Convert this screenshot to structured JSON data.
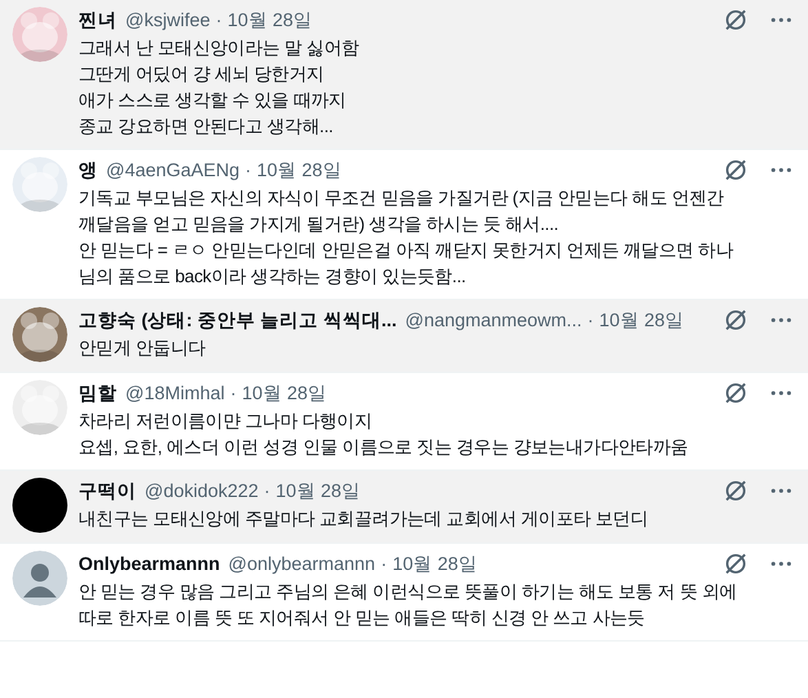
{
  "tweets": [
    {
      "name": "찐녀",
      "handle": "@ksjwifee",
      "separator": "·",
      "date": "10월 28일",
      "highlighted": true,
      "text": "그래서 난 모태신앙이라는 말 싫어함\n그딴게 어딨어 걍 세뇌 당한거지\n애가 스스로 생각할 수 있을 때까지\n종교 강요하면 안된다고 생각해..."
    },
    {
      "name": "앵",
      "handle": "@4aenGaAENg",
      "separator": "·",
      "date": "10월 28일",
      "highlighted": false,
      "text": "기독교 부모님은 자신의 자식이 무조건 믿음을 가질거란 (지금 안믿는다 해도 언젠간\n깨달음을 얻고 믿음을 가지게 될거란) 생각을 하시는 듯 해서....\n안 믿는다 = ㄹㅇ 안믿는다인데 안믿은걸 아직 깨닫지 못한거지 언제든 깨달으면 하나\n님의 품으로 back이라 생각하는 경향이 있는듯함..."
    },
    {
      "name": "고향숙 (상태: 중안부 늘리고 씩씩대...",
      "handle": "@nangmanmeowm...",
      "separator": "·",
      "date": "10월 28일",
      "highlighted": true,
      "text": "안믿게 안둡니다"
    },
    {
      "name": "밈할",
      "handle": "@18Mimhal",
      "separator": "·",
      "date": "10월 28일",
      "highlighted": false,
      "text": "차라리 저런이름이먄 그나마 다행이지\n요셉, 요한, 에스더 이런 성경 인물 이름으로 짓는 경우는 걍보는내가다안타까움"
    },
    {
      "name": "구떡이",
      "handle": "@dokidok222",
      "separator": "·",
      "date": "10월 28일",
      "highlighted": true,
      "avatar": {
        "kind": "solid",
        "color": "#000000"
      },
      "text": "내친구는 모태신앙에 주말마다 교회끌려가는데 교회에서 게이포타 보던디"
    },
    {
      "name": "Onlybearmannn",
      "handle": "@onlybearmannn",
      "separator": "·",
      "date": "10월 28일",
      "highlighted": false,
      "avatar": {
        "kind": "default",
        "color": "#ccd6dd"
      },
      "text": "안 믿는 경우 많음 그리고 주님의 은혜 이런식으로 뜻풀이 하기는 해도 보통 저 뜻 외에\n따로 한자로 이름 뜻 또 지어줘서 안 믿는 애들은 딱히 신경 안 쓰고 사는듯"
    }
  ]
}
